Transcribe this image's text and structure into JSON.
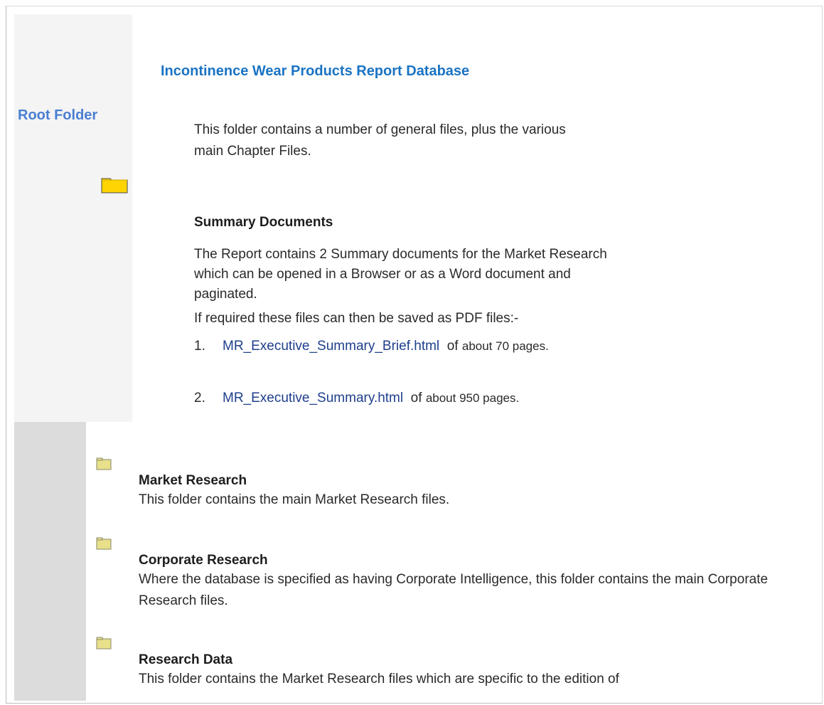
{
  "left_panel": {
    "title": "Root Folder",
    "icon": "folder-icon"
  },
  "header": {
    "title": "Incontinence Wear Products Report Database"
  },
  "intro": {
    "line1": "This folder contains a number of general files, plus the various",
    "line2": "main Chapter Files."
  },
  "summary": {
    "heading": "Summary Documents",
    "description": "The Report contains 2 Summary documents for the Market Research which can be opened in a Browser or as a Word document and paginated.",
    "pdf_note": "If required these files can then be saved as PDF files:-",
    "items": [
      {
        "number": "1.",
        "link": "MR_Executive_Summary_Brief.html",
        "of": "of",
        "pages": "about 70 pages."
      },
      {
        "number": "2.",
        "link": "MR_Executive_Summary.html",
        "of": "of",
        "pages": "about 950 pages."
      }
    ]
  },
  "sections": [
    {
      "icon": "folder-icon",
      "title": "Market Research",
      "description": "This folder contains the main Market Research files."
    },
    {
      "icon": "folder-icon",
      "title": "Corporate Research",
      "description": "Where the database is specified as having Corporate Intelligence, this folder contains the main Corporate Research files."
    },
    {
      "icon": "folder-icon",
      "title": "Research Data",
      "description": "This folder contains the Market Research files which are specific to the edition of"
    }
  ],
  "colors": {
    "left_title": "#4a7fd2",
    "db_title": "#1a73c3",
    "link": "#1f3f8c",
    "folder_yellow": "#ffd700",
    "small_folder": "#e8e08a",
    "left_bg": "#f4f4f4",
    "strip_bg": "#dcdcdc"
  }
}
